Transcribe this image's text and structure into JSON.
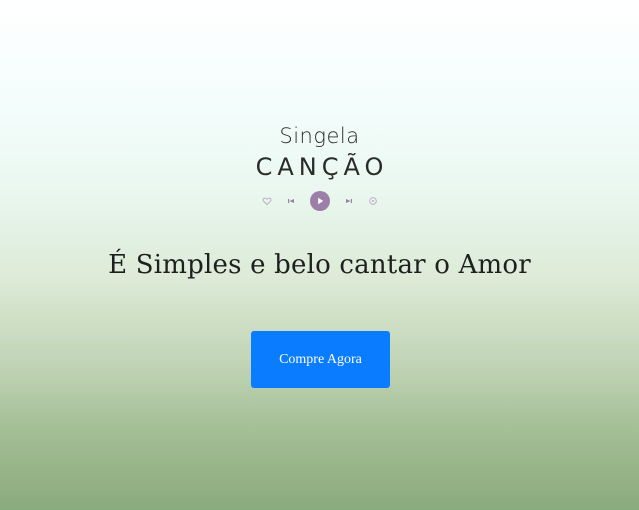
{
  "logo": {
    "line1": "Singela",
    "line2": "CANÇÃO"
  },
  "player": {
    "icons": [
      "heart-icon",
      "previous-icon",
      "play-icon",
      "next-icon",
      "share-icon"
    ],
    "play_color": "#9c7fa8"
  },
  "hero": {
    "tagline": "É Simples e belo cantar o Amor"
  },
  "cta": {
    "label": "Compre Agora",
    "color": "#0a7cff"
  }
}
